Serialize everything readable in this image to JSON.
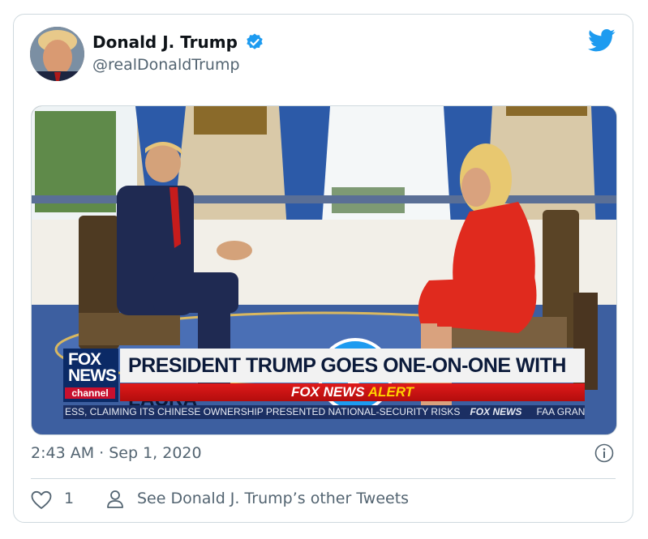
{
  "tweet": {
    "author_name": "Donald J. Trump",
    "author_handle": "@realDonaldTrump",
    "timestamp": "2:43 AM · Sep 1, 2020",
    "like_count": "1",
    "other_tweets_link": "See Donald J. Trump’s other Tweets"
  },
  "video": {
    "logo_line1": "FOX",
    "logo_line2": "NEWS",
    "logo_line3": "channel",
    "headline": "PRESIDENT TRUMP GOES ONE-ON-ONE WITH LAURA",
    "alert_brand": "FOX NEWS",
    "alert_word": "ALERT",
    "ticker_text": "ESS, CLAIMING ITS CHINESE OWNERSHIP PRESENTED NATIONAL-SECURITY RISKS",
    "ticker_brand": "FOX NEWS",
    "ticker_tail": "FAA GRAN"
  },
  "icons": {
    "verified": "verified-badge-icon",
    "bird": "twitter-bird-icon",
    "play": "play-icon",
    "info": "info-icon",
    "like": "heart-icon",
    "person": "person-icon"
  },
  "colors": {
    "accent": "#1d9bf0",
    "text_secondary": "#536471",
    "border": "#cfd9de"
  }
}
